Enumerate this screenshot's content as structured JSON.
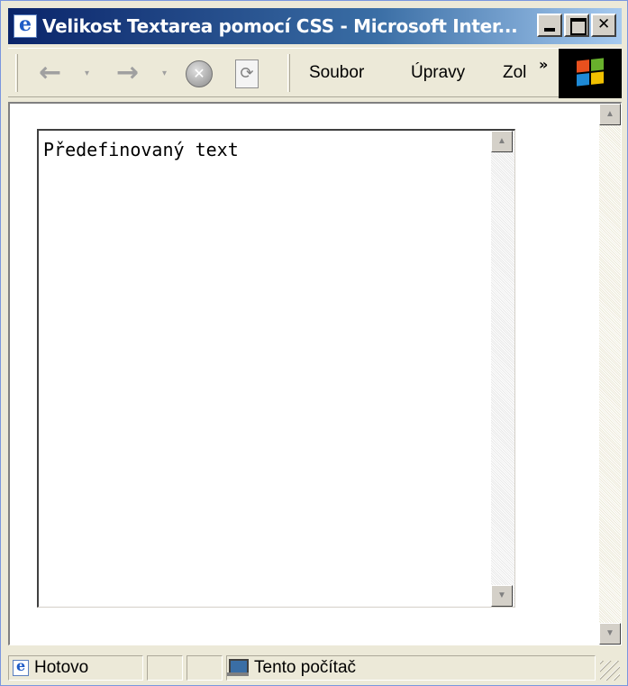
{
  "window": {
    "title": "Velikost Textarea pomocí CSS - Microsoft Inter...",
    "accent_color": "#0a246a"
  },
  "toolbar": {
    "back_icon": "back-arrow-icon",
    "forward_icon": "forward-arrow-icon",
    "stop_icon": "stop-icon",
    "refresh_icon": "refresh-icon",
    "back_glyph": "←",
    "forward_glyph": "→",
    "dropdown_glyph": "▾",
    "stop_glyph": "✕",
    "refresh_glyph": "⟳",
    "overflow_glyph": "»"
  },
  "menu": {
    "items": [
      "Soubor",
      "Úpravy",
      "Zol"
    ]
  },
  "content": {
    "textarea_value": "Předefinovaný text"
  },
  "statusbar": {
    "status_text": "Hotovo",
    "zone_text": "Tento počítač"
  }
}
